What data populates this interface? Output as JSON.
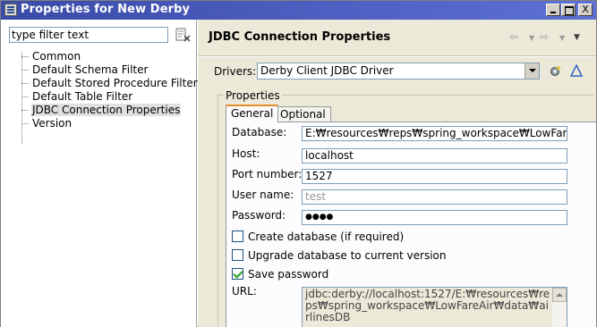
{
  "window": {
    "title": "Properties for New Derby",
    "minimize_label": "_",
    "maximize_label": "□",
    "close_label": "X"
  },
  "left_pane": {
    "filter_placeholder": "type filter text",
    "filter_value": "type filter text",
    "tree_items": [
      {
        "label": "Common"
      },
      {
        "label": "Default Schema Filter"
      },
      {
        "label": "Default Stored Procedure Filter"
      },
      {
        "label": "Default Table Filter"
      },
      {
        "label": "JDBC Connection Properties",
        "selected": true
      },
      {
        "label": "Version"
      }
    ]
  },
  "right_pane": {
    "title": "JDBC Connection Properties",
    "nav_back": "⇦",
    "nav_forward": "⇨",
    "drivers_label": "Drivers:",
    "drivers_value": "Derby Client JDBC Driver",
    "properties_label": "Properties",
    "tabs": {
      "general": "General",
      "optional": "Optional"
    },
    "fields": {
      "database_label": "Database:",
      "database_value": "E:₩resources₩reps₩spring_workspace₩LowFareA",
      "host_label": "Host:",
      "host_value": "localhost",
      "port_label": "Port number:",
      "port_value": "1527",
      "username_label": "User name:",
      "username_value": "test",
      "password_label": "Password:",
      "password_value": "●●●●"
    },
    "checkboxes": {
      "create_db": {
        "label": "Create database (if required)",
        "checked": false
      },
      "upgrade_db": {
        "label": "Upgrade database to current version",
        "checked": false
      },
      "save_password": {
        "label": "Save password",
        "checked": true
      }
    },
    "url_label": "URL:",
    "url_value": "jdbc:derby://localhost:1527/E:₩resources₩reps₩spring_workspace₩LowFareAir₩data₩airlinesDB"
  },
  "colors": {
    "titlebar_start": "#3a4aa8",
    "titlebar_end": "#5d71d4",
    "dialog_bg": "#ece9d8",
    "tab_accent": "#e68b2c"
  }
}
